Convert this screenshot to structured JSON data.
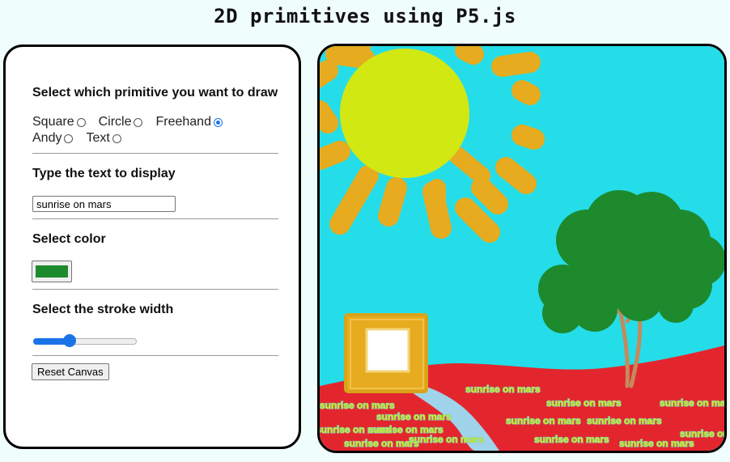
{
  "page": {
    "title": "2D primitives using P5.js"
  },
  "controls": {
    "primitive_title": "Select which primitive you want to draw",
    "primitives": [
      {
        "label": "Square",
        "checked": false
      },
      {
        "label": "Circle",
        "checked": false
      },
      {
        "label": "Freehand",
        "checked": true
      },
      {
        "label": "Andy",
        "checked": false
      },
      {
        "label": "Text",
        "checked": false
      }
    ],
    "text_title": "Type the text to display",
    "text_value": "sunrise on mars",
    "color_title": "Select color",
    "color_value": "#1e8a2e",
    "stroke_title": "Select the stroke width",
    "stroke_fraction": 0.35,
    "reset_label": "Reset Canvas"
  },
  "canvas": {
    "sky_color": "#24dde8",
    "ground_color": "#e3262e",
    "sun_color": "#d1e813",
    "ray_color": "#e6ab1f",
    "tree_color": "#1e8a2e",
    "trunk_color": "#c58a5c",
    "river_color": "#9fd3ea",
    "stamp_text": "sunrise on mars",
    "stamp_fill": "#d1e813",
    "stamp_outline": "#7fd1c9"
  }
}
